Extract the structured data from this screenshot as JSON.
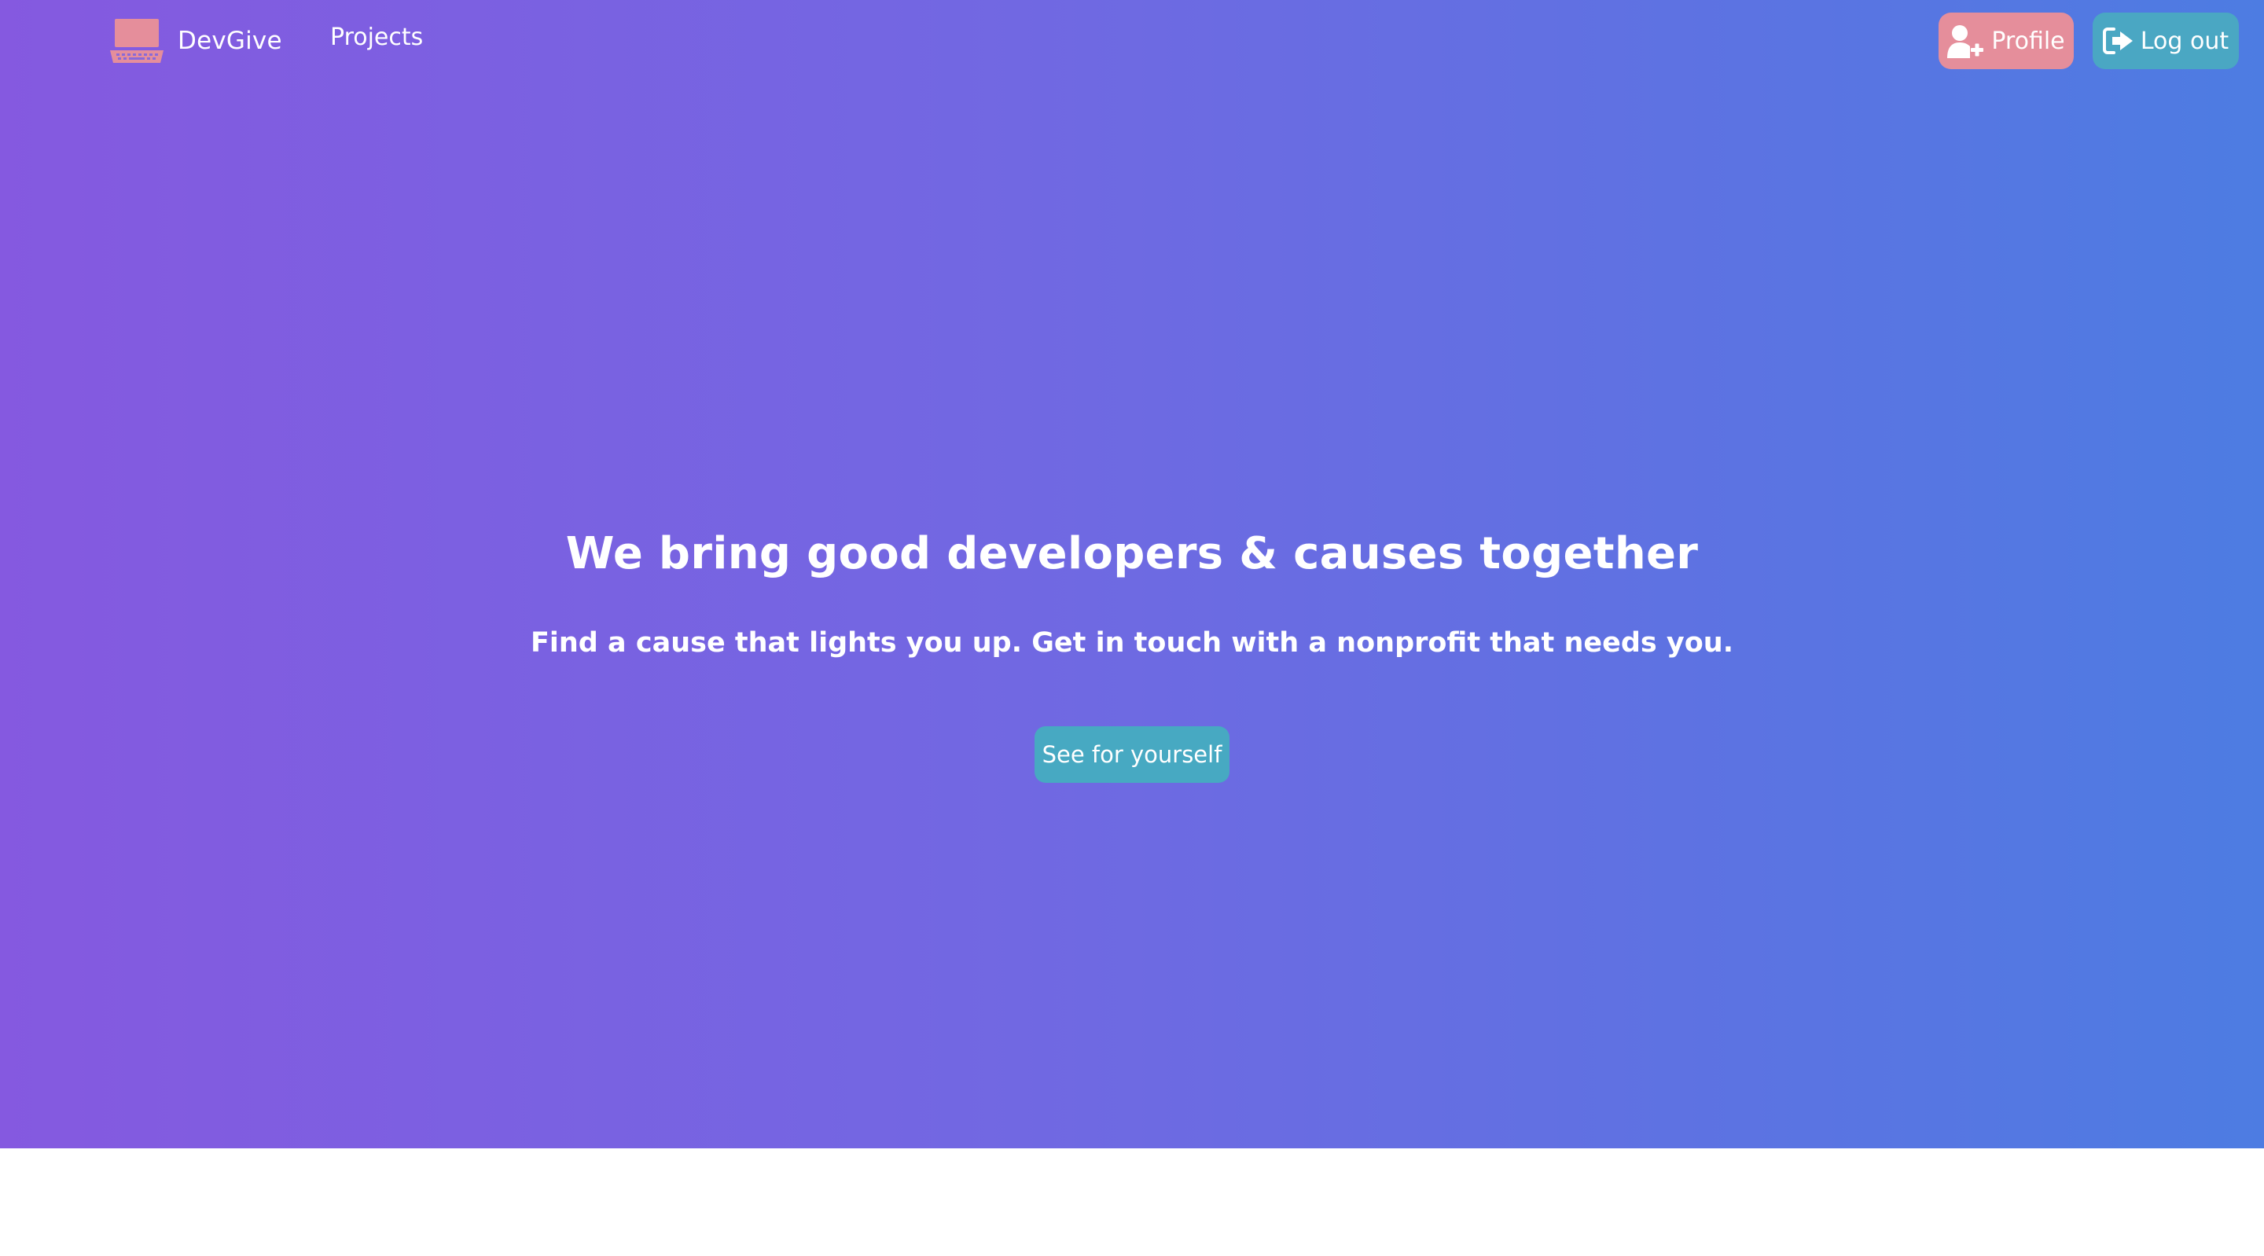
{
  "navbar": {
    "brand_name": "DevGive",
    "logo_icon": "laptop-icon",
    "links": [
      {
        "label": "Projects"
      }
    ],
    "profile_button": {
      "label": "Profile",
      "icon": "user-plus-icon"
    },
    "logout_button": {
      "label": "Log out",
      "icon": "sign-out-icon"
    }
  },
  "hero": {
    "title": "We bring good developers & causes together",
    "subtitle": "Find a cause that lights you up. Get in touch with a nonprofit that needs you.",
    "cta_label": "See for yourself"
  },
  "colors": {
    "gradient_start": "#8559e0",
    "gradient_end": "#4d7ce2",
    "profile_button": "#e58e9b",
    "logout_button": "#4aa7c3",
    "cta_button": "#47a9c2",
    "logo": "#e58e9b",
    "text": "#ffffff"
  }
}
